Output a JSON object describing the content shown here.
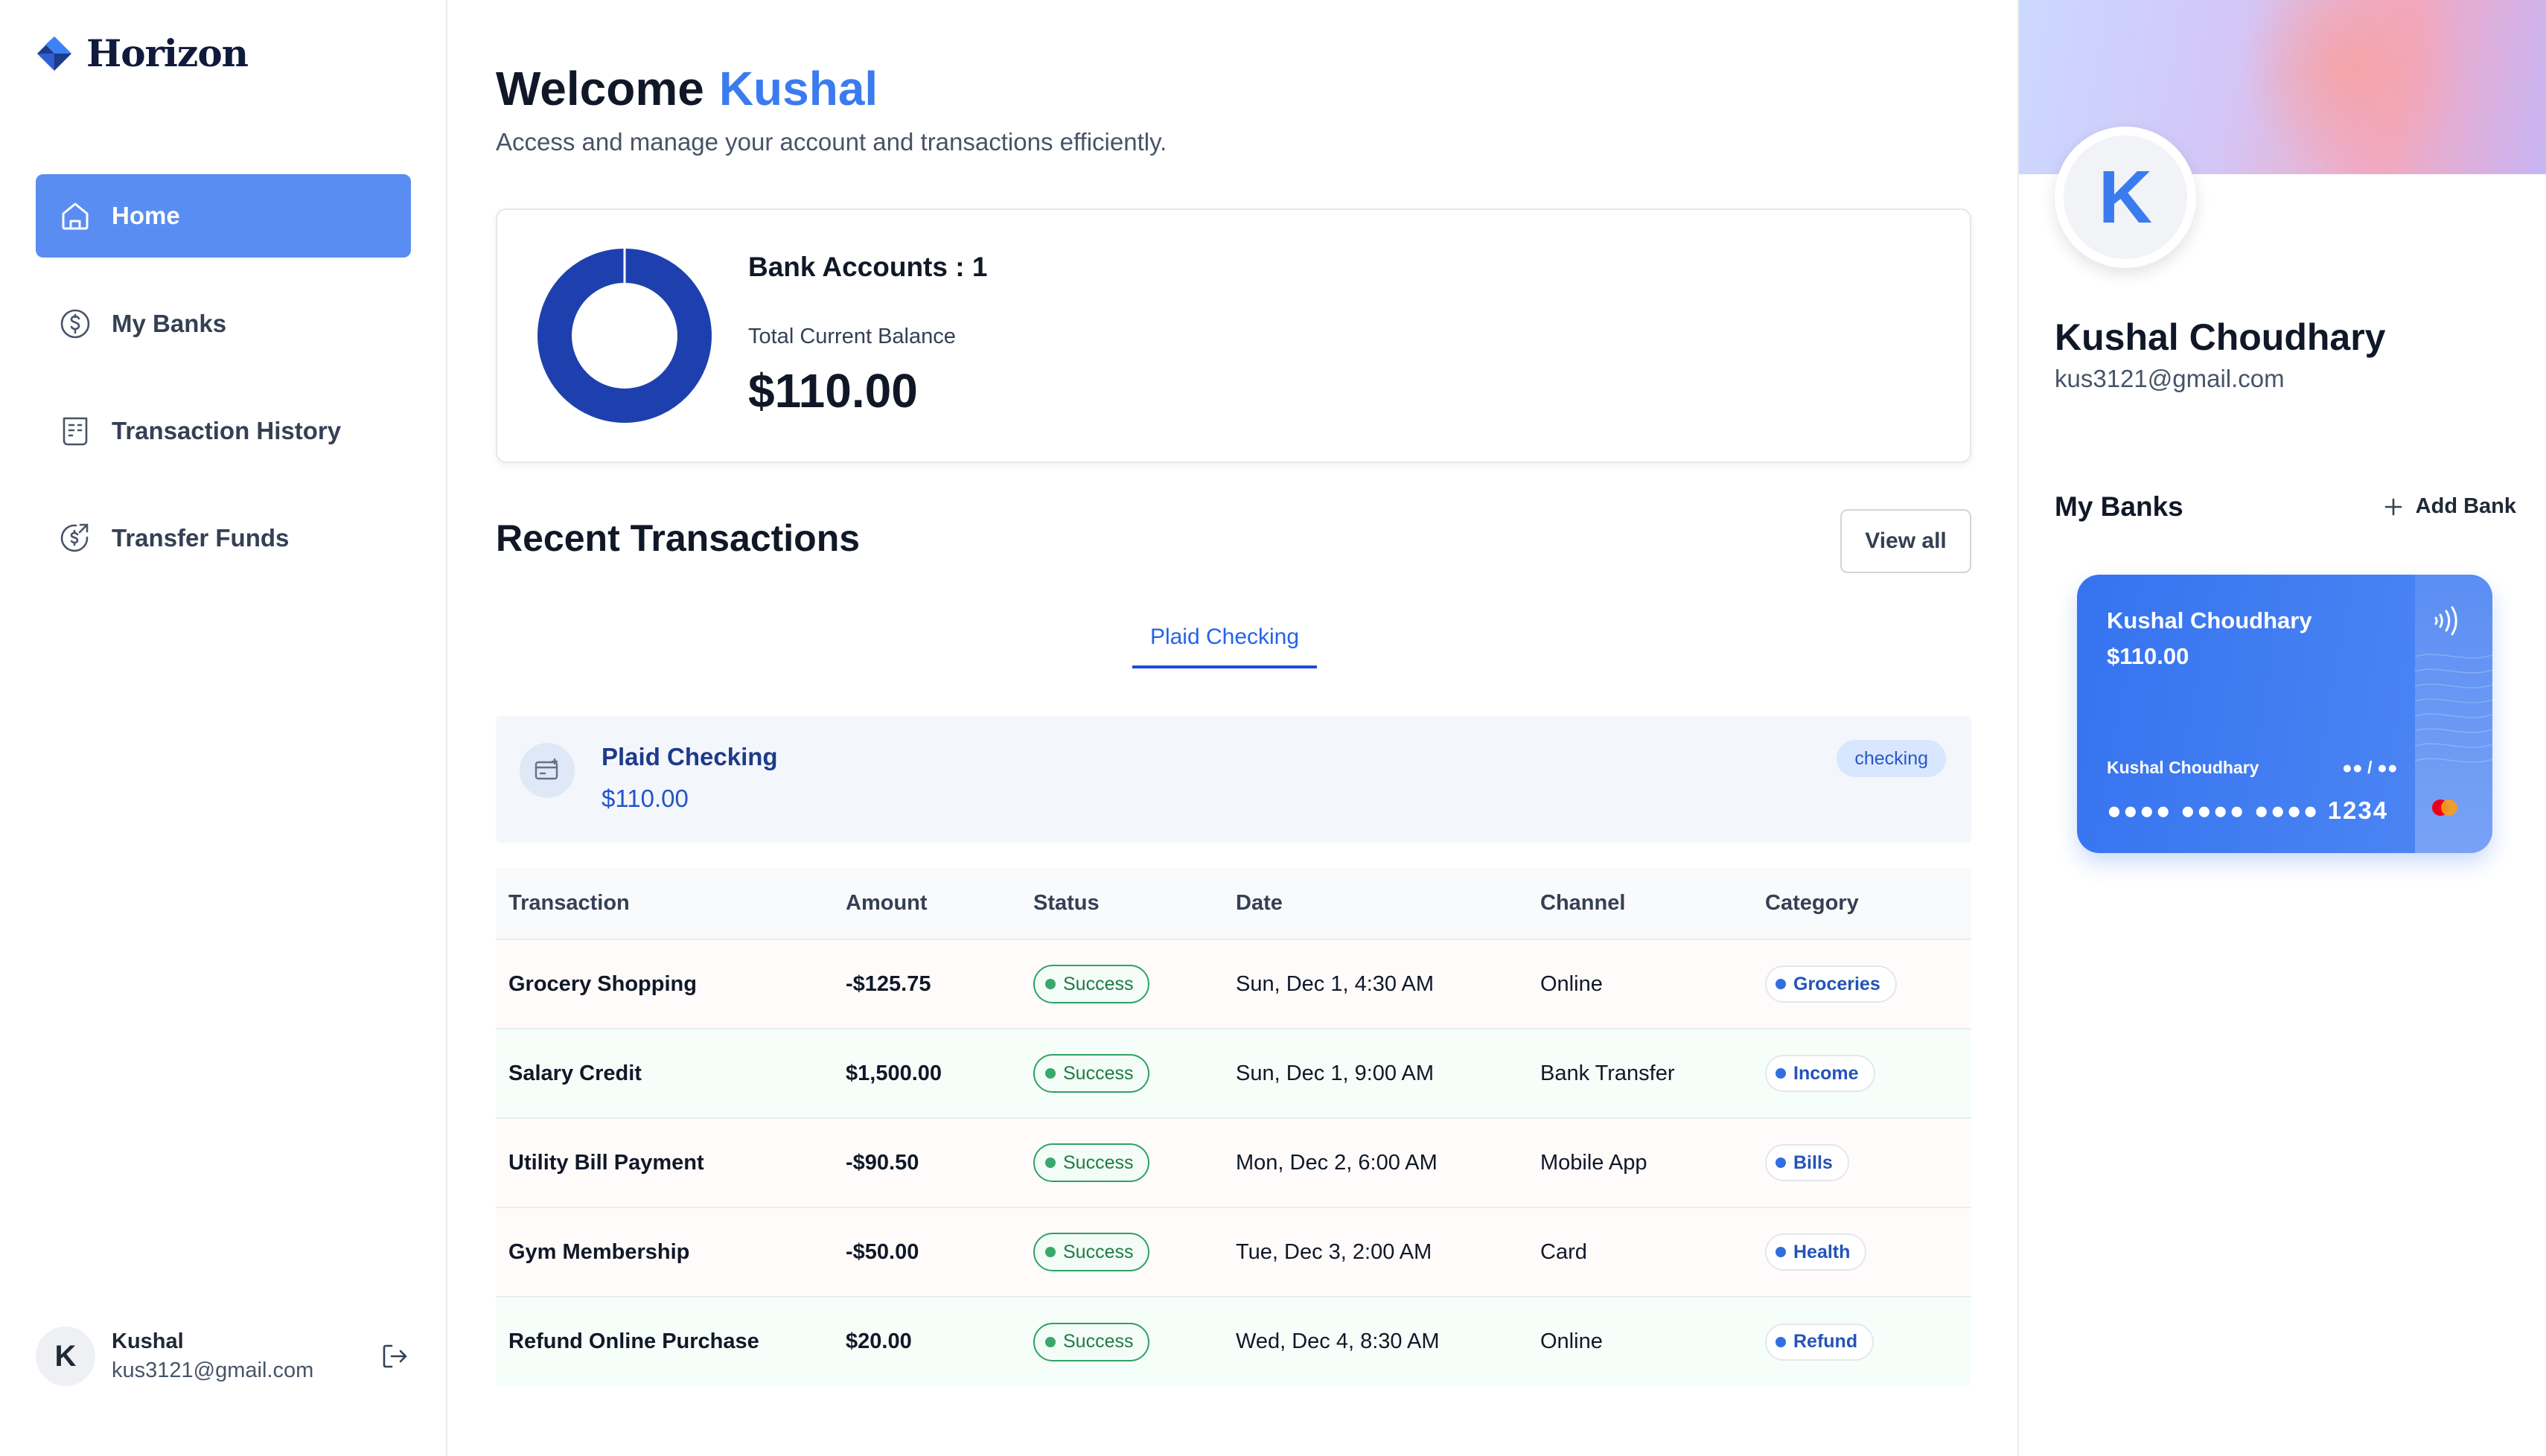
{
  "sidebar": {
    "brand": "Horizon",
    "nav": [
      {
        "label": "Home",
        "icon": "home-icon",
        "active": true
      },
      {
        "label": "My Banks",
        "icon": "dollar-circle-icon",
        "active": false
      },
      {
        "label": "Transaction History",
        "icon": "receipt-icon",
        "active": false
      },
      {
        "label": "Transfer Funds",
        "icon": "money-send-icon",
        "active": false
      }
    ],
    "footer": {
      "initial": "K",
      "name": "Kushal",
      "email": "kus3121@gmail.com"
    }
  },
  "header": {
    "welcome": "Welcome",
    "user": "Kushal",
    "subtitle": "Access and manage your account and transactions efficiently."
  },
  "balance": {
    "accounts_label": "Bank Accounts : 1",
    "total_label": "Total Current Balance",
    "total": "$110.00"
  },
  "recent": {
    "title": "Recent Transactions",
    "view_all": "View all",
    "tab": "Plaid Checking",
    "account": {
      "name": "Plaid Checking",
      "balance": "$110.00",
      "type": "checking"
    },
    "columns": [
      "Transaction",
      "Amount",
      "Status",
      "Date",
      "Channel",
      "Category"
    ],
    "rows": [
      {
        "name": "Grocery Shopping",
        "amount": "-$125.75",
        "kind": "debit",
        "status": "Success",
        "date": "Sun, Dec 1, 4:30 AM",
        "channel": "Online",
        "category": "Groceries"
      },
      {
        "name": "Salary Credit",
        "amount": "$1,500.00",
        "kind": "credit",
        "status": "Success",
        "date": "Sun, Dec 1, 9:00 AM",
        "channel": "Bank Transfer",
        "category": "Income"
      },
      {
        "name": "Utility Bill Payment",
        "amount": "-$90.50",
        "kind": "debit",
        "status": "Success",
        "date": "Mon, Dec 2, 6:00 AM",
        "channel": "Mobile App",
        "category": "Bills"
      },
      {
        "name": "Gym Membership",
        "amount": "-$50.00",
        "kind": "debit",
        "status": "Success",
        "date": "Tue, Dec 3, 2:00 AM",
        "channel": "Card",
        "category": "Health"
      },
      {
        "name": "Refund Online Purchase",
        "amount": "$20.00",
        "kind": "credit",
        "status": "Success",
        "date": "Wed, Dec 4, 8:30 AM",
        "channel": "Online",
        "category": "Refund"
      }
    ]
  },
  "profile": {
    "initial": "K",
    "name": "Kushal Choudhary",
    "email": "kus3121@gmail.com",
    "my_banks": "My Banks",
    "add_bank": "Add Bank",
    "card": {
      "bank_name": "Kushal Choudhary",
      "balance": "$110.00",
      "holder": "Kushal Choudhary",
      "expiry": "●● / ●●",
      "number": "●●●● ●●●● ●●●● 1234"
    }
  },
  "colors": {
    "accent": "#3b7bf0",
    "nav_active": "#5a8df2",
    "donut": "#1e40af",
    "debit": "#e5413d",
    "credit": "#2f9e5a"
  }
}
